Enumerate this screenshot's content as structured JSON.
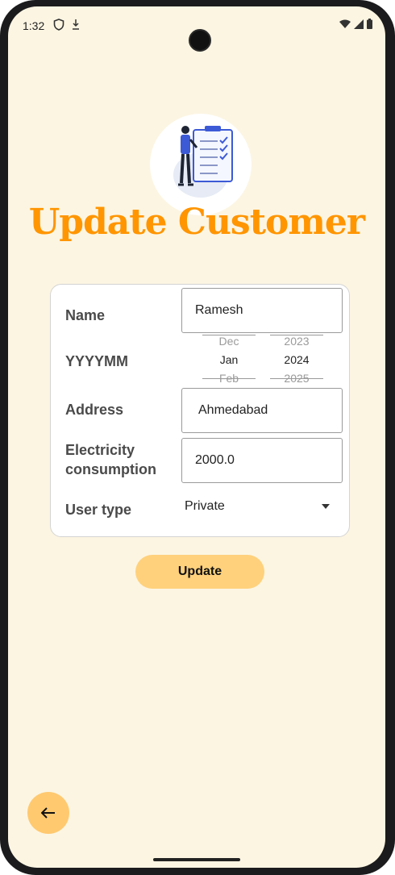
{
  "status_bar": {
    "time": "1:32"
  },
  "header": {
    "title": "Update Customer"
  },
  "form": {
    "name_label": "Name",
    "name_value": "Ramesh",
    "yyyymm_label": "YYYYMM",
    "month_picker": {
      "prev": "Dec",
      "selected": "Jan",
      "next": "Feb"
    },
    "year_picker": {
      "prev": "2023",
      "selected": "2024",
      "next": "2025"
    },
    "address_label": "Address",
    "address_value": "Ahmedabad",
    "consumption_label_line1": "Electricity",
    "consumption_label_line2": "consumption",
    "consumption_value": "2000.0",
    "user_type_label": "User type",
    "user_type_value": "Private"
  },
  "actions": {
    "update_label": "Update",
    "back_icon": "arrow-left-icon"
  },
  "colors": {
    "accent": "#ff9500",
    "button": "#ffd17c",
    "background": "#fcf5e2"
  }
}
